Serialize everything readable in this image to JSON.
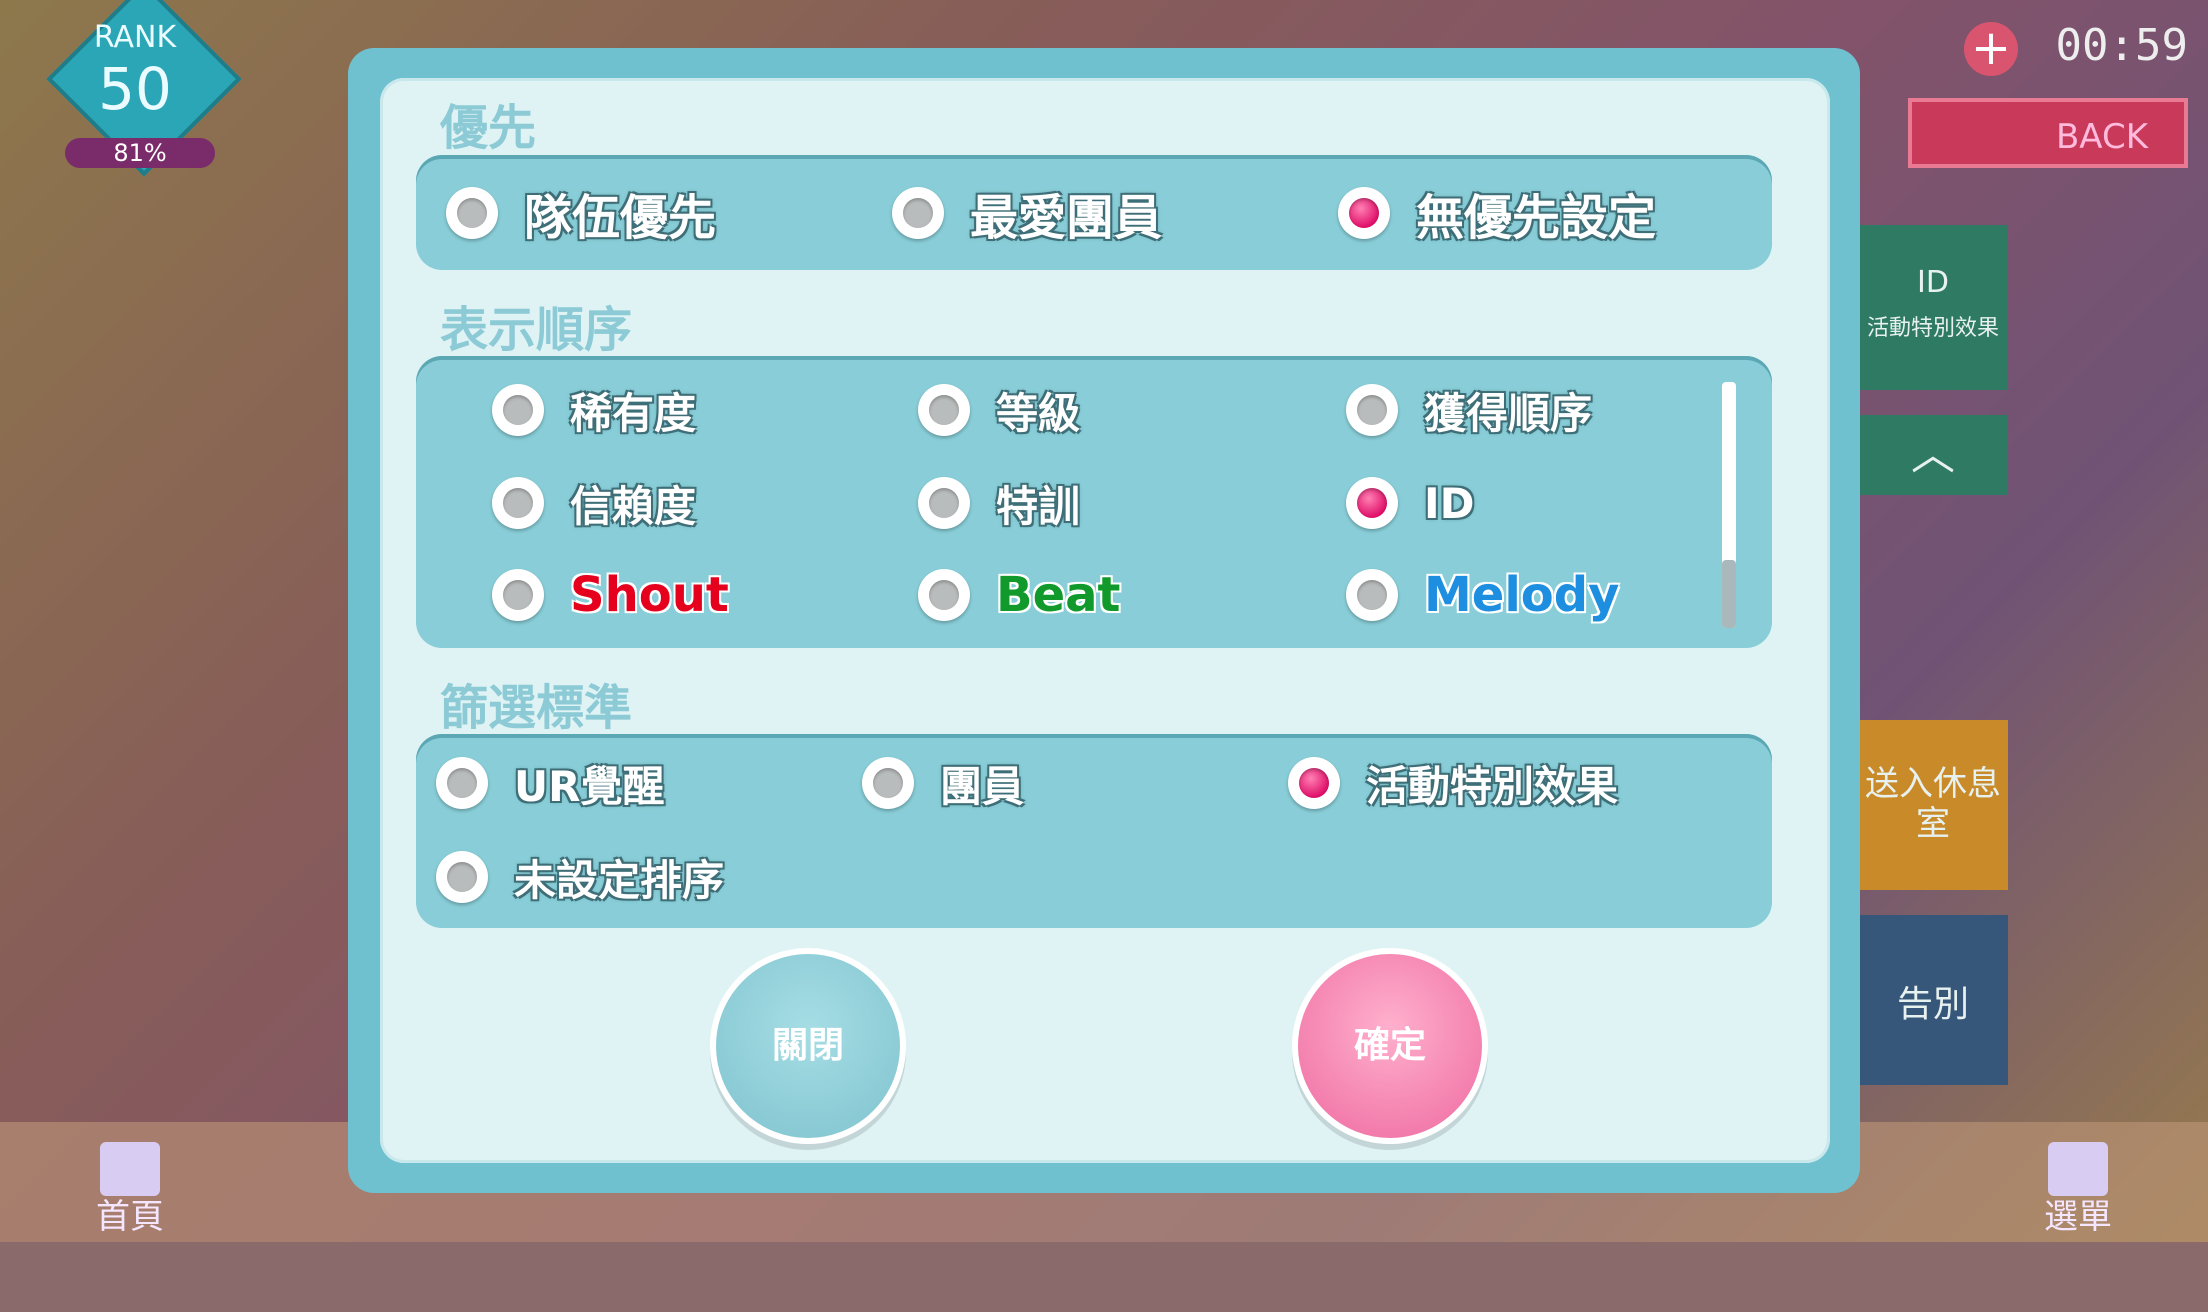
{
  "hud": {
    "rank_label": "RANK",
    "rank_value": "50",
    "rank_progress_text": "81%",
    "clock": "00:59",
    "back_label": "BACK"
  },
  "side": {
    "id_title": "ID",
    "id_sub": "活動特別效果",
    "rest_label": "送入休息室",
    "bye_label": "告別"
  },
  "nav": {
    "home": "首頁",
    "menu": "選單"
  },
  "dialog": {
    "priority_title": "優先",
    "priority_options": [
      "隊伍優先",
      "最愛團員",
      "無優先設定"
    ],
    "priority_selected": 2,
    "order_title": "表示順序",
    "order_options": [
      "稀有度",
      "等級",
      "獲得順序",
      "信賴度",
      "特訓",
      "ID",
      "Shout",
      "Beat",
      "Melody"
    ],
    "order_selected": 5,
    "filter_title": "篩選標準",
    "filter_options": [
      "UR覺醒",
      "團員",
      "活動特別效果",
      "未設定排序"
    ],
    "filter_selected": 2,
    "close_label": "關閉",
    "confirm_label": "確定"
  },
  "colors": {
    "panel_outer": "#6fc1cf",
    "group_bg": "#88cdd7",
    "selected_radio": "#e0106a",
    "shout": "#e5001e",
    "beat": "#119a2b",
    "melody": "#1e8fe0",
    "confirm_button": "#ee6aa0",
    "close_button": "#7fc3ce"
  }
}
